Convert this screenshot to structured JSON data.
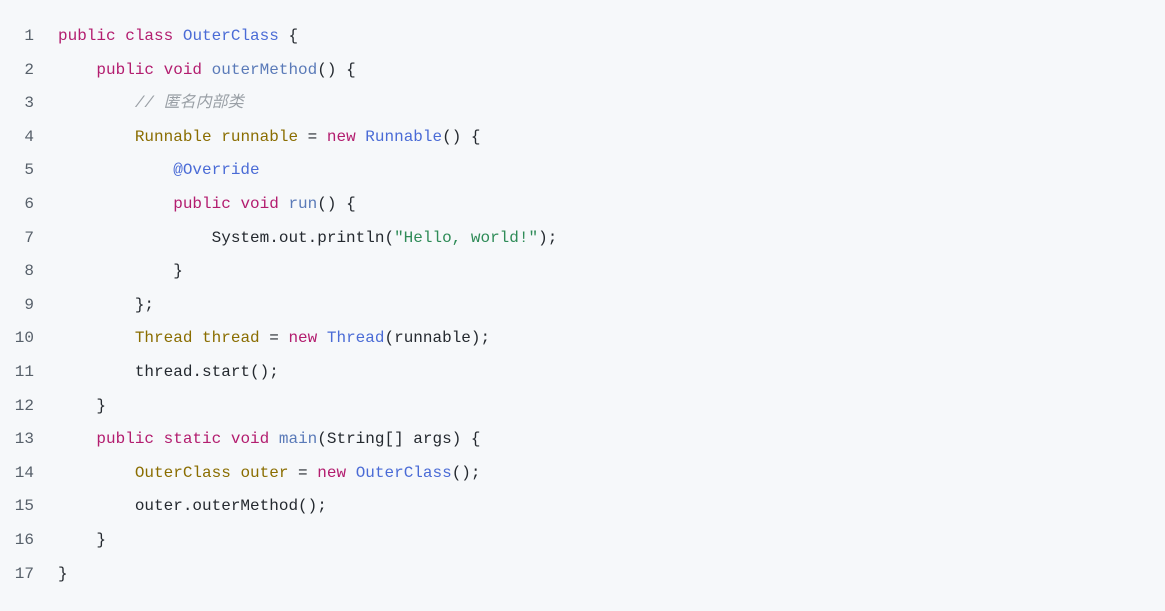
{
  "code": {
    "lines": [
      {
        "num": "1",
        "tokens": [
          {
            "cls": "kw",
            "t": "public"
          },
          {
            "cls": "plain",
            "t": " "
          },
          {
            "cls": "kw",
            "t": "class"
          },
          {
            "cls": "plain",
            "t": " "
          },
          {
            "cls": "type",
            "t": "OuterClass"
          },
          {
            "cls": "plain",
            "t": " {"
          }
        ]
      },
      {
        "num": "2",
        "tokens": [
          {
            "cls": "plain",
            "t": "    "
          },
          {
            "cls": "kw",
            "t": "public"
          },
          {
            "cls": "plain",
            "t": " "
          },
          {
            "cls": "kw",
            "t": "void"
          },
          {
            "cls": "plain",
            "t": " "
          },
          {
            "cls": "method",
            "t": "outerMethod"
          },
          {
            "cls": "plain",
            "t": "() {"
          }
        ]
      },
      {
        "num": "3",
        "tokens": [
          {
            "cls": "plain",
            "t": "        "
          },
          {
            "cls": "comment",
            "t": "// 匿名内部类"
          }
        ]
      },
      {
        "num": "4",
        "tokens": [
          {
            "cls": "plain",
            "t": "        "
          },
          {
            "cls": "var",
            "t": "Runnable"
          },
          {
            "cls": "plain",
            "t": " "
          },
          {
            "cls": "var",
            "t": "runnable"
          },
          {
            "cls": "plain",
            "t": " = "
          },
          {
            "cls": "kw",
            "t": "new"
          },
          {
            "cls": "plain",
            "t": " "
          },
          {
            "cls": "type",
            "t": "Runnable"
          },
          {
            "cls": "plain",
            "t": "() {"
          }
        ]
      },
      {
        "num": "5",
        "tokens": [
          {
            "cls": "plain",
            "t": "            "
          },
          {
            "cls": "annot",
            "t": "@Override"
          }
        ]
      },
      {
        "num": "6",
        "tokens": [
          {
            "cls": "plain",
            "t": "            "
          },
          {
            "cls": "kw",
            "t": "public"
          },
          {
            "cls": "plain",
            "t": " "
          },
          {
            "cls": "kw",
            "t": "void"
          },
          {
            "cls": "plain",
            "t": " "
          },
          {
            "cls": "method",
            "t": "run"
          },
          {
            "cls": "plain",
            "t": "() {"
          }
        ]
      },
      {
        "num": "7",
        "tokens": [
          {
            "cls": "plain",
            "t": "                System.out.println("
          },
          {
            "cls": "str",
            "t": "\"Hello, world!\""
          },
          {
            "cls": "plain",
            "t": ");"
          }
        ]
      },
      {
        "num": "8",
        "tokens": [
          {
            "cls": "plain",
            "t": "            }"
          }
        ]
      },
      {
        "num": "9",
        "tokens": [
          {
            "cls": "plain",
            "t": "        };"
          }
        ]
      },
      {
        "num": "10",
        "tokens": [
          {
            "cls": "plain",
            "t": "        "
          },
          {
            "cls": "var",
            "t": "Thread"
          },
          {
            "cls": "plain",
            "t": " "
          },
          {
            "cls": "var",
            "t": "thread"
          },
          {
            "cls": "plain",
            "t": " = "
          },
          {
            "cls": "kw",
            "t": "new"
          },
          {
            "cls": "plain",
            "t": " "
          },
          {
            "cls": "type",
            "t": "Thread"
          },
          {
            "cls": "plain",
            "t": "(runnable);"
          }
        ]
      },
      {
        "num": "11",
        "tokens": [
          {
            "cls": "plain",
            "t": "        thread.start();"
          }
        ]
      },
      {
        "num": "12",
        "tokens": [
          {
            "cls": "plain",
            "t": "    }"
          }
        ]
      },
      {
        "num": "13",
        "tokens": [
          {
            "cls": "plain",
            "t": "    "
          },
          {
            "cls": "kw",
            "t": "public"
          },
          {
            "cls": "plain",
            "t": " "
          },
          {
            "cls": "kw",
            "t": "static"
          },
          {
            "cls": "plain",
            "t": " "
          },
          {
            "cls": "kw",
            "t": "void"
          },
          {
            "cls": "plain",
            "t": " "
          },
          {
            "cls": "method",
            "t": "main"
          },
          {
            "cls": "plain",
            "t": "(String[] args) {"
          }
        ]
      },
      {
        "num": "14",
        "tokens": [
          {
            "cls": "plain",
            "t": "        "
          },
          {
            "cls": "var",
            "t": "OuterClass"
          },
          {
            "cls": "plain",
            "t": " "
          },
          {
            "cls": "var",
            "t": "outer"
          },
          {
            "cls": "plain",
            "t": " = "
          },
          {
            "cls": "kw",
            "t": "new"
          },
          {
            "cls": "plain",
            "t": " "
          },
          {
            "cls": "type",
            "t": "OuterClass"
          },
          {
            "cls": "plain",
            "t": "();"
          }
        ]
      },
      {
        "num": "15",
        "tokens": [
          {
            "cls": "plain",
            "t": "        outer.outerMethod();"
          }
        ]
      },
      {
        "num": "16",
        "tokens": [
          {
            "cls": "plain",
            "t": "    }"
          }
        ]
      },
      {
        "num": "17",
        "tokens": [
          {
            "cls": "plain",
            "t": "}"
          }
        ]
      }
    ]
  }
}
